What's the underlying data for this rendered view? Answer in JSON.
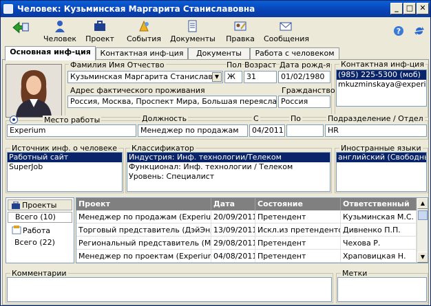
{
  "window": {
    "title": "Человек: Кузьминская Маргарита Станиславовна"
  },
  "toolbar": {
    "items": [
      "Человек",
      "Проект",
      "События",
      "Документы",
      "Правка",
      "Сообщения"
    ]
  },
  "tabs": [
    "Основная инф-ция",
    "Контактная инф-ция",
    "Документы",
    "Работа с человеком"
  ],
  "person": {
    "fio_label": "Фамилия Имя Отчество",
    "fio": "Кузьминская Маргарита Станиславовна",
    "sex_label": "Пол",
    "sex": "Ж",
    "age_label": "Возраст",
    "age": "31",
    "birth_label": "Дата рожд-я",
    "birth": "01/02/1980",
    "address_label": "Адрес фактического проживания",
    "address": "Россия, Москва, Проспект Мира, Большая переяславская,",
    "citizenship_label": "Гражданство",
    "citizenship": "Россия"
  },
  "contact": {
    "label": "Контактная инф-ция",
    "items": [
      "(985) 225-5300 (моб)",
      "mkuzminskaya@experium.ru"
    ]
  },
  "job": {
    "workplace_label": "Место работы",
    "workplace": "Experium",
    "position_label": "Должность",
    "position": "Менеджер по продажам",
    "from_label": "С",
    "from": "04/2011",
    "to_label": "По",
    "to": "",
    "dept_label": "Подразделение / Отдел",
    "dept": "HR"
  },
  "source": {
    "label": "Источник инф. о человеке",
    "items": [
      "Работный сайт",
      "SuperJob"
    ]
  },
  "classifier": {
    "label": "Классификатор",
    "items": [
      "Индустрия: Инф. технологии/Телеком",
      "Функционал: Инф. технологии / Телеком",
      "Уровень: Специалист"
    ]
  },
  "languages": {
    "label": "Иностранные языки",
    "items": [
      "английский (Свободный)"
    ]
  },
  "side": {
    "projects_label": "Проекты",
    "projects_total": "Всего (10)",
    "work_label": "Работа",
    "work_total": "Всего (22)"
  },
  "table": {
    "headers": [
      "Проект",
      "Дата",
      "Состояние",
      "Ответственный"
    ],
    "rows": [
      [
        "Менеджер по продажам (Experium)",
        "20/09/2011",
        "Претендент",
        "Кузьминская М.С."
      ],
      [
        "Торговый представитель (ДэйЭндНайт)",
        "13/09/2011",
        "Искл.из претендентов",
        "Дивненко П.П."
      ],
      [
        "Региональный представитель (Michelin)",
        "29/08/2011",
        "Претендент",
        "Чехова Р."
      ],
      [
        "Менеджер по проектам (Experium)",
        "04/08/2011",
        "Претендент",
        "Храповицкая Н."
      ]
    ]
  },
  "comments": {
    "label": "Комментарии"
  },
  "tags": {
    "label": "Метки"
  }
}
